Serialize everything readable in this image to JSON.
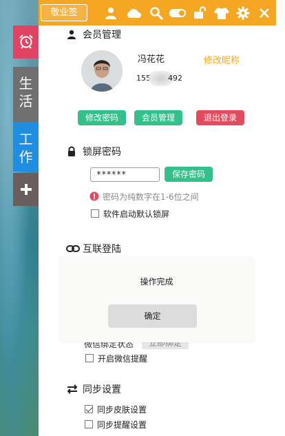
{
  "topbar": {
    "brand": "敬业签",
    "color": "#f5a623",
    "icons": [
      "user-icon",
      "cloud-icon",
      "search-icon",
      "toggle-icon",
      "unlock-icon",
      "shirt-icon",
      "gear-icon",
      "close-icon"
    ]
  },
  "sidebar": {
    "items": [
      {
        "icon": "alarm-clock-icon",
        "color": "#e04462"
      },
      {
        "label": "生\n活",
        "color": "#6f6f6f"
      },
      {
        "label": "工\n作",
        "color": "#1f8de0"
      },
      {
        "icon": "plus-icon",
        "color": "#6a5d5d"
      }
    ]
  },
  "member": {
    "title": "会员管理",
    "nickname": "冯花花",
    "phone_start": "1550",
    "phone_end": "492",
    "edit_nick_label": "修改昵称",
    "buttons": {
      "change_password": "修改密码",
      "member_manage": "会员管理",
      "logout": "退出登录"
    }
  },
  "lock": {
    "title": "锁屏密码",
    "password_value": "******",
    "save_label": "保存密码",
    "hint": "密码为纯数字在1-6位之间",
    "startup_lock_label": "软件启动默认锁屏",
    "startup_lock_checked": false
  },
  "connect": {
    "title": "互联登陆",
    "wechat_status_label": "微信绑定状态",
    "wechat_bind_label": "立即绑定",
    "wechat_remind_label": "开启微信提醒",
    "wechat_remind_checked": false
  },
  "sync": {
    "title": "同步设置",
    "items": [
      {
        "label": "同步皮肤设置",
        "checked": true
      },
      {
        "label": "同步提醒设置",
        "checked": false
      }
    ]
  },
  "dialog": {
    "message": "操作完成",
    "ok_label": "确定"
  },
  "colors": {
    "accent_green": "#33c08a",
    "accent_red": "#e24a5e",
    "accent_orange": "#f5a623"
  }
}
